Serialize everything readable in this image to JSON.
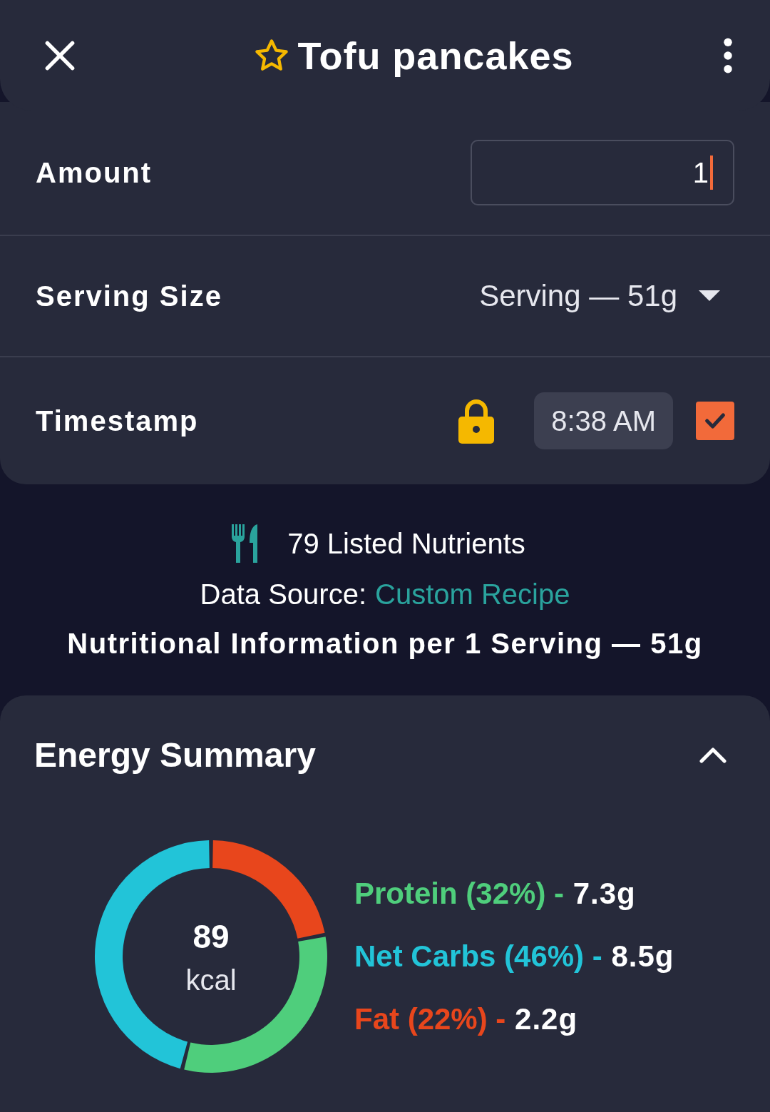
{
  "header": {
    "title": "Tofu pancakes",
    "favorite": false
  },
  "fields": [
    {
      "kind": "input",
      "label": "Amount",
      "value": "1"
    },
    {
      "kind": "dropdown",
      "label": "Serving Size",
      "value": "Serving  — 51g"
    },
    {
      "kind": "time",
      "label": "Timestamp",
      "locked": true,
      "value": "8:38 AM",
      "checked": true
    }
  ],
  "info": {
    "nutrient_count": "79 Listed Nutrients",
    "source_label": "Data Source:",
    "source": "Custom Recipe",
    "per_serving": "Nutritional Information per 1 Serving  — 51g"
  },
  "energy": {
    "title": "Energy Summary",
    "expanded": true,
    "kcal": "89",
    "unit": "kcal",
    "macros": [
      {
        "share": "(32%) -",
        "amount": "7.3g",
        "color": "#4fce7c"
      },
      {
        "share": "(46%) -",
        "amount": "8.5g",
        "color": "#22c4d8"
      },
      {
        "share": "(22%) -",
        "amount": "2.2g",
        "color": "#e8461c"
      }
    ],
    "chart_data": {
      "type": "donut",
      "categories": [
        "Protein",
        "Net Carbs",
        "Fat"
      ],
      "values": [
        32,
        46,
        22
      ]
    }
  }
}
